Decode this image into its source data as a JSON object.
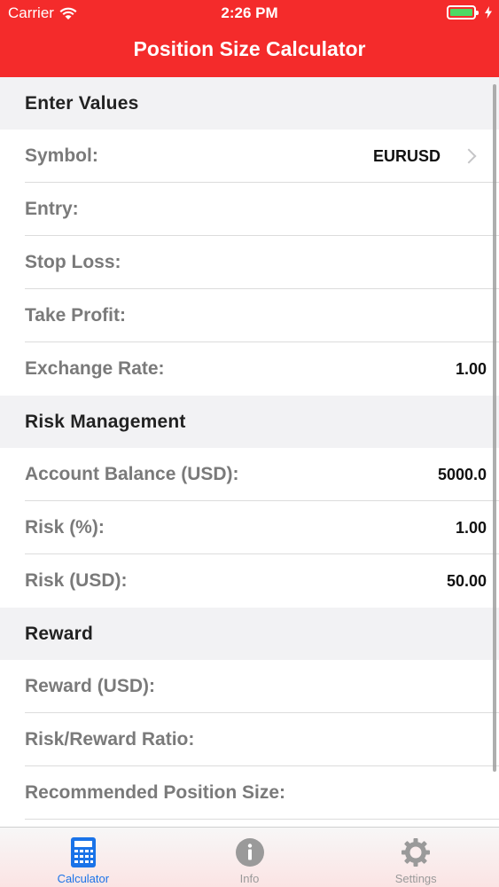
{
  "status_bar": {
    "carrier": "Carrier",
    "time": "2:26 PM",
    "battery_color": "#4cd964"
  },
  "header": {
    "title": "Position Size Calculator",
    "background": "#f42b2b"
  },
  "sections": {
    "enter_values": {
      "title": "Enter Values",
      "symbol": {
        "label": "Symbol:",
        "value": "EURUSD"
      },
      "entry": {
        "label": "Entry:",
        "value": ""
      },
      "stop_loss": {
        "label": "Stop Loss:",
        "value": ""
      },
      "take_profit": {
        "label": "Take Profit:",
        "value": ""
      },
      "exchange_rate": {
        "label": "Exchange Rate:",
        "value": "1.00"
      }
    },
    "risk_management": {
      "title": "Risk Management",
      "account_balance": {
        "label": "Account Balance (USD):",
        "value": "5000.0"
      },
      "risk_percent": {
        "label": "Risk (%):",
        "value": "1.00"
      },
      "risk_usd": {
        "label": "Risk (USD):",
        "value": "50.00"
      }
    },
    "reward": {
      "title": "Reward",
      "reward_usd": {
        "label": "Reward (USD):",
        "value": ""
      },
      "risk_reward_ratio": {
        "label": "Risk/Reward Ratio:",
        "value": ""
      },
      "recommended_position_size": {
        "label": "Recommended Position Size:",
        "value": ""
      }
    }
  },
  "tab_bar": {
    "tabs": [
      {
        "label": "Calculator",
        "icon": "calculator-icon",
        "active": true
      },
      {
        "label": "Info",
        "icon": "info-icon",
        "active": false
      },
      {
        "label": "Settings",
        "icon": "gear-icon",
        "active": false
      }
    ],
    "active_color": "#1a73e8",
    "inactive_color": "#9a9a9a"
  }
}
